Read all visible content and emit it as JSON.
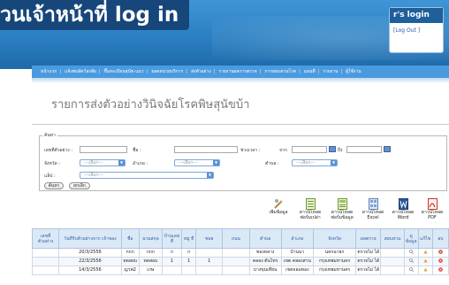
{
  "overlay_title": "วนเจ้าหน้าที่ log in",
  "login": {
    "title": "r's login",
    "logout": "[Log Out ]"
  },
  "nav": [
    "หน้าแรก",
    "แจ้งพบสัตว์สงสัย",
    "ขึ้นทะเบียนสุนัข-แมว",
    "ยอดหน่วยบริการ",
    "ส่งตัวอย่าง",
    "รายงานผลการตรวจ",
    "การสอบสวนโรค",
    "แผนที่",
    "รายงาน",
    "ผู้ใช้งาน"
  ],
  "page_title": "รายการส่งตัวอย่างวินิจฉัยโรคพิษสุนัขบ้า",
  "search": {
    "legend": "ค้นหา",
    "sample_no_label": "เลขที่ตัวอย่าง :",
    "name_label": "ชื่อ :",
    "date_range_label": "ช่วงเวลา :",
    "from_label": "จาก",
    "to_label": "ถึง",
    "province_label": "จังหวัด :",
    "district_label": "อำเภอ :",
    "subdistrict_label": "ตำบล :",
    "lab_label": "แล็ป :",
    "select_placeholder": "---เลือก---",
    "search_button": "ค้นหา",
    "cancel_button": "ยกเลิก"
  },
  "toolbar": [
    {
      "label": "เพิ่มข้อมูล",
      "icon": "add-icon"
    },
    {
      "label": "ดาวน์โหลด ฟอร์มเปล่า",
      "icon": "blank-form-icon"
    },
    {
      "label": "ดาวน์โหลด ฟอร์มข้อมูล",
      "icon": "data-form-icon"
    },
    {
      "label": "ดาวน์โหลด Excel",
      "icon": "excel-icon"
    },
    {
      "label": "ดาวน์โหลด Word",
      "icon": "word-icon"
    },
    {
      "label": "ดาวน์โหลด PDF",
      "icon": "pdf-icon"
    }
  ],
  "table": {
    "headers": [
      "เลขที่ ตัวอย่าง",
      "วันที่รับตัวอย่างจาก เจ้าของ",
      "ชื่อ",
      "นามสกุล",
      "บ้านเลข ที่",
      "หมู่ ที่",
      "ซอย",
      "ถนน",
      "ตำบล",
      "อำเภอ",
      "จังหวัด",
      "ผลตรวจ",
      "สอบสวน",
      "ดู ข้อมูล",
      "แก้ไข",
      "ลบ"
    ],
    "rows": [
      [
        "",
        "20/3/2556",
        "กกก",
        "กกก",
        "ก",
        "ก",
        "",
        "",
        "ทองหลาง",
        "บ้านนา",
        "นครนายก",
        "ตรวจไม่ ได้",
        "",
        "",
        "",
        ""
      ],
      [
        "",
        "22/3/2556",
        "ทดสอบ",
        "ทดสอบ",
        "1",
        "1",
        "1",
        "",
        "คลอง ต้นไทร",
        "เขต คลองสาน",
        "กรุงเทพมหานคร",
        "ตรวจไม่ ได้",
        "",
        "",
        "",
        ""
      ],
      [
        "",
        "14/3/2556",
        "ญวพ2",
        "เกษ",
        "",
        "",
        "",
        "",
        "บางขุนเทียน",
        "เขตจอมทอง",
        "กรุงเทพมหานคร",
        "ตรวจไม่ ได้",
        "",
        "",
        "",
        ""
      ]
    ]
  },
  "colors": {
    "header_blue": "#2a7fc2",
    "nav_blue": "#4a9ae0",
    "overlay_navy": "#16467a",
    "table_header": "#dbe9f7"
  }
}
